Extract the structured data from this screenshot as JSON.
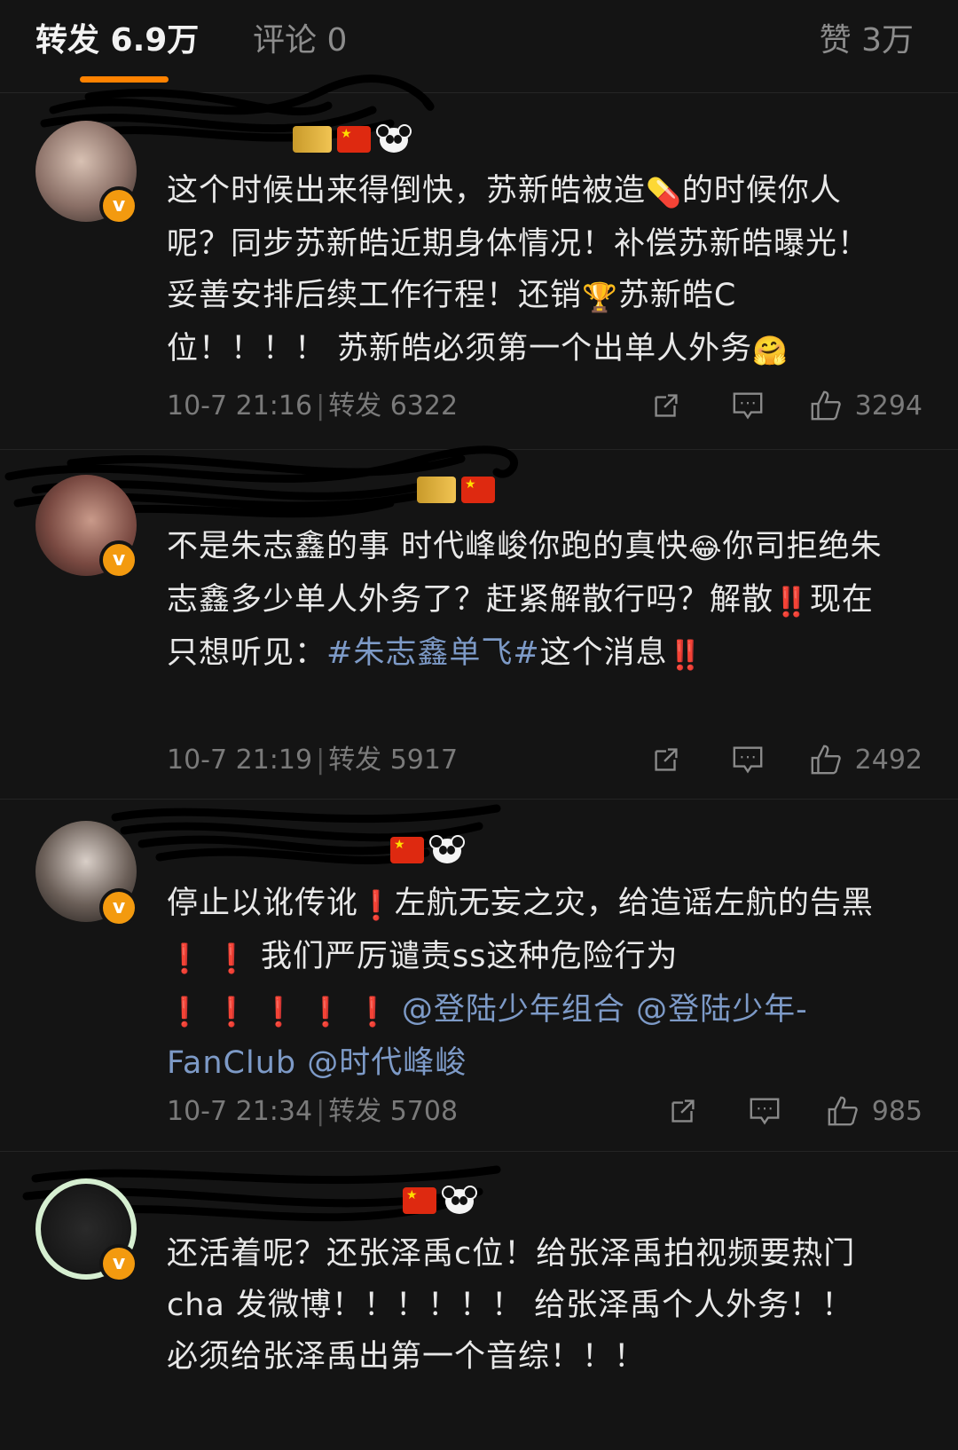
{
  "header": {
    "tab_repost": "转发 6.9万",
    "tab_comment": "评论 0",
    "tab_like": "赞 3万",
    "accent": "#ff8200"
  },
  "posts": [
    {
      "body_1": "这个时候出来得倒快，苏新皓被造",
      "emoji_1": "💊",
      "body_2": "的时候你人呢？同步苏新皓近期身体情况！补偿苏新皓曝光！妥善安排后续工作行程！还销",
      "emoji_2": "🏆",
      "body_3": "苏新皓C位！！！！ 苏新皓必须第一个出单人外务",
      "emoji_3": "🤗",
      "time": "10-7 21:16",
      "repost_label": "转发 6322",
      "likes": "3294"
    },
    {
      "body_1": "不是朱志鑫的事 时代峰峻你跑的真快",
      "emoji_1": "😂",
      "body_2": "你司拒绝朱志鑫多少单人外务了？赶紧解散行吗？解散",
      "emoji_2": "‼️",
      "body_3": "现在只想听见：",
      "hashtag": "#朱志鑫单飞#",
      "body_4": "这个消息",
      "emoji_3": "‼️",
      "time": "10-7 21:19",
      "repost_label": "转发 5917",
      "likes": "2492"
    },
    {
      "body_1": "停止以讹传讹",
      "emoji_1": "❗",
      "body_2": "左航无妄之灾，给造谣左航的告黑",
      "emoji_2": "❗ ❗",
      "body_3": "我们严厉谴责ss这种危险行为",
      "emoji_3": "❗ ❗ ❗ ❗ ❗",
      "mention_1": "@登陆少年组合",
      "mention_2": "@登陆少年-FanClub",
      "mention_3": "@时代峰峻",
      "time": "10-7 21:34",
      "repost_label": "转发 5708",
      "likes": "985"
    },
    {
      "body_1": "还活着呢？还张泽禹c位！给张泽禹拍视频要热门cha 发微博！！！！！！ 给张泽禹个人外务！！ 必须给张泽禹出第一个音综！！！"
    }
  ]
}
